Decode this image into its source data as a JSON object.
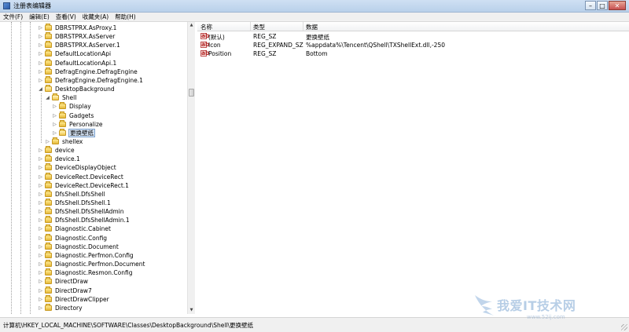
{
  "window": {
    "title": "注册表编辑器",
    "buttons": {
      "minimize": "–",
      "maximize": "□",
      "close": "✕"
    }
  },
  "menu": [
    "文件(F)",
    "编辑(E)",
    "查看(V)",
    "收藏夹(A)",
    "帮助(H)"
  ],
  "tree": {
    "items": [
      {
        "label": "DBRSTPRX.AsProxy.1",
        "depth": 0,
        "toggle": "closed"
      },
      {
        "label": "DBRSTPRX.AsServer",
        "depth": 0,
        "toggle": "closed"
      },
      {
        "label": "DBRSTPRX.AsServer.1",
        "depth": 0,
        "toggle": "closed"
      },
      {
        "label": "DefaultLocationApi",
        "depth": 0,
        "toggle": "closed"
      },
      {
        "label": "DefaultLocationApi.1",
        "depth": 0,
        "toggle": "closed"
      },
      {
        "label": "DefragEngine.DefragEngine",
        "depth": 0,
        "toggle": "closed"
      },
      {
        "label": "DefragEngine.DefragEngine.1",
        "depth": 0,
        "toggle": "closed"
      },
      {
        "label": "DesktopBackground",
        "depth": 0,
        "toggle": "open"
      },
      {
        "label": "Shell",
        "depth": 1,
        "toggle": "open"
      },
      {
        "label": "Display",
        "depth": 2,
        "toggle": "closed"
      },
      {
        "label": "Gadgets",
        "depth": 2,
        "toggle": "closed"
      },
      {
        "label": "Personalize",
        "depth": 2,
        "toggle": "closed"
      },
      {
        "label": "更换壁纸",
        "depth": 2,
        "toggle": "closed",
        "selected": true
      },
      {
        "label": "shellex",
        "depth": 1,
        "toggle": "closed"
      },
      {
        "label": "device",
        "depth": 0,
        "toggle": "closed"
      },
      {
        "label": "device.1",
        "depth": 0,
        "toggle": "closed"
      },
      {
        "label": "DeviceDisplayObject",
        "depth": 0,
        "toggle": "closed"
      },
      {
        "label": "DeviceRect.DeviceRect",
        "depth": 0,
        "toggle": "closed"
      },
      {
        "label": "DeviceRect.DeviceRect.1",
        "depth": 0,
        "toggle": "closed"
      },
      {
        "label": "DfsShell.DfsShell",
        "depth": 0,
        "toggle": "closed"
      },
      {
        "label": "DfsShell.DfsShell.1",
        "depth": 0,
        "toggle": "closed"
      },
      {
        "label": "DfsShell.DfsShellAdmin",
        "depth": 0,
        "toggle": "closed"
      },
      {
        "label": "DfsShell.DfsShellAdmin.1",
        "depth": 0,
        "toggle": "closed"
      },
      {
        "label": "Diagnostic.Cabinet",
        "depth": 0,
        "toggle": "closed"
      },
      {
        "label": "Diagnostic.Config",
        "depth": 0,
        "toggle": "closed"
      },
      {
        "label": "Diagnostic.Document",
        "depth": 0,
        "toggle": "closed"
      },
      {
        "label": "Diagnostic.Perfmon.Config",
        "depth": 0,
        "toggle": "closed"
      },
      {
        "label": "Diagnostic.Perfmon.Document",
        "depth": 0,
        "toggle": "closed"
      },
      {
        "label": "Diagnostic.Resmon.Config",
        "depth": 0,
        "toggle": "closed"
      },
      {
        "label": "DirectDraw",
        "depth": 0,
        "toggle": "closed"
      },
      {
        "label": "DirectDraw7",
        "depth": 0,
        "toggle": "closed"
      },
      {
        "label": "DirectDrawClipper",
        "depth": 0,
        "toggle": "closed"
      },
      {
        "label": "Directory",
        "depth": 0,
        "toggle": "closed"
      }
    ]
  },
  "values_list": {
    "columns": [
      "名称",
      "类型",
      "数据"
    ],
    "rows": [
      {
        "icon": "string-value-icon",
        "icon_text": "ab",
        "name": "(默认)",
        "type": "REG_SZ",
        "data": "更换壁纸"
      },
      {
        "icon": "string-value-icon",
        "icon_text": "ab",
        "name": "Icon",
        "type": "REG_EXPAND_SZ",
        "data": "%appdata%\\Tencent\\QShell\\TXShellExt.dll,-250"
      },
      {
        "icon": "string-value-icon",
        "icon_text": "ab",
        "name": "Position",
        "type": "REG_SZ",
        "data": "Bottom"
      }
    ]
  },
  "status_bar": {
    "path": "计算机\\HKEY_LOCAL_MACHINE\\SOFTWARE\\Classes\\DesktopBackground\\Shell\\更换壁纸"
  },
  "watermark": {
    "main": "我爱IT技术网",
    "sub": "www.52ij.com"
  },
  "colors": {
    "title_bar": "#c4d8ee",
    "selection": "#d8e6f7",
    "close_button": "#c75050"
  }
}
